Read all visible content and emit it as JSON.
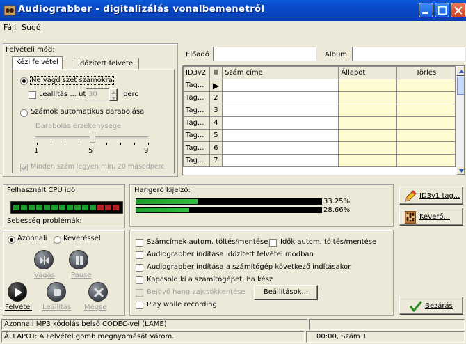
{
  "window": {
    "title": "Audiograbber - digitalizálás vonalbemenetről"
  },
  "menu": {
    "items": [
      "Fájl",
      "Súgó"
    ]
  },
  "rec_mode": {
    "label": "Felvételi mód:",
    "tabs": [
      "Kézi felvétel",
      "Időzített felvétel"
    ],
    "option_no_split": "Ne vágd szét számokra",
    "stop_after_label": "Leállítás ... után",
    "stop_after_value": "30",
    "minutes_label": "perc",
    "option_auto_split": "Számok automatikus darabolása",
    "sensitivity_label": "Darabolás érzékenysége",
    "slider_ticks": [
      "1",
      "5",
      "9"
    ],
    "slider_level": 5,
    "min_length_label": "Minden szám legyen min. 20 másodperc"
  },
  "track_info": {
    "artist_label": "Előadó",
    "artist_value": "",
    "album_label": "Album",
    "album_value": ""
  },
  "track_table": {
    "headers": [
      "ID3v2",
      "II",
      "Szám címe",
      "Állapot",
      "Törlés"
    ],
    "rows": [
      {
        "tag": "Tag...",
        "num": "▶"
      },
      {
        "tag": "Tag...",
        "num": "2"
      },
      {
        "tag": "Tag...",
        "num": "3"
      },
      {
        "tag": "Tag...",
        "num": "4"
      },
      {
        "tag": "Tag...",
        "num": "5"
      },
      {
        "tag": "Tag...",
        "num": "6"
      },
      {
        "tag": "Tag...",
        "num": "7"
      }
    ]
  },
  "cpu": {
    "label": "Felhasznált CPU idő",
    "speed_label": "Sebesség problémák:"
  },
  "volume": {
    "label": "Hangerő kijelző:",
    "left_percent": "33.25%",
    "right_percent": "28.66%",
    "left_level": 0.3325,
    "right_level": 0.2866
  },
  "side_buttons": {
    "id3v1": "ID3v1 tag...",
    "mixer": "Keverő..."
  },
  "mode": {
    "immediate": "Azonnali",
    "mix": "Keveréssel"
  },
  "controls": {
    "cut": "Vágás",
    "pause": "Pause",
    "record": "Felvétel",
    "stop": "Leállítás",
    "abort": "Mégse"
  },
  "options": {
    "auto_save_titles": "Számcímek autom. töltés/mentése",
    "auto_save_times": "Idők autom. töltés/mentése",
    "start_timed": "Audiograbber indítása időzített felvétel módban",
    "start_on_boot": "Audiograbber indítása a számítógép következő indításakor",
    "shutdown_when_done": "Kapcsold ki a számítógépet, ha kész",
    "noise_reduction": "Bejövő hang zajcsökkentése",
    "settings_button": "Beállítások...",
    "play_while_recording": "Play while recording"
  },
  "close_button": "Bezárás",
  "status": {
    "codec": "Azonnali MP3 kódolás belső CODEC-vel (LAME)",
    "state": "ÁLLAPOT: A Felvétel gomb megnyomását várom.",
    "position": "00:00, Szám 1"
  },
  "colors": {
    "titlebar": "#0a48c8",
    "meter_green": "#1a9a2a",
    "meter_red": "#b02020",
    "window_bg": "#ece9d8",
    "row_yellow": "#fffbd0"
  }
}
